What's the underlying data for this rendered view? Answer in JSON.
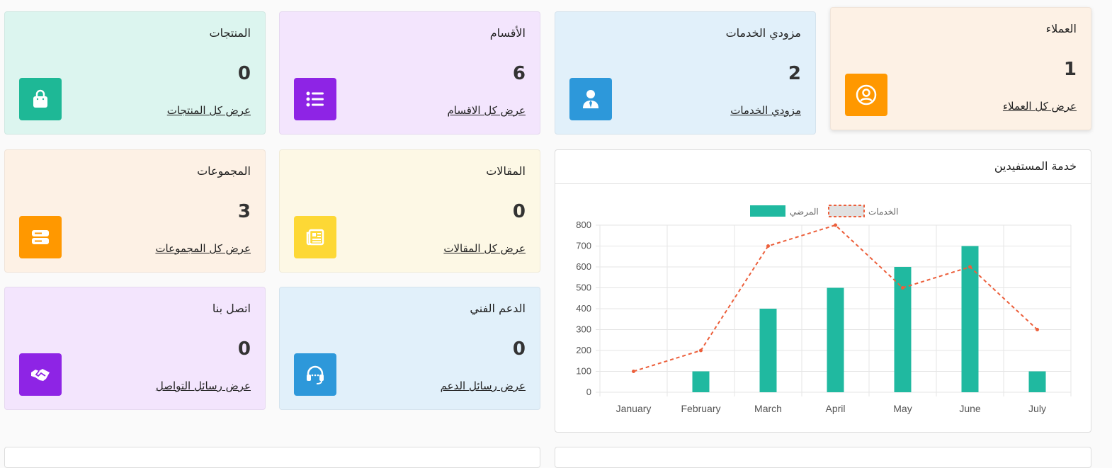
{
  "cards": {
    "clients": {
      "title": "العملاء",
      "value": "1",
      "link": "عرض كل العملاء",
      "bg": "#fdf1e5",
      "icon_bg": "#ff9800",
      "icon": "user-circle-icon"
    },
    "providers": {
      "title": "مزودي الخدمات",
      "value": "2",
      "link": "مزودي الخدمات",
      "bg": "#e1f0fa",
      "icon_bg": "#2d98da",
      "icon": "person-tie-icon"
    },
    "sections": {
      "title": "الأقسام",
      "value": "6",
      "link": "عرض كل الاقسام",
      "bg": "#f3e5fd",
      "icon_bg": "#8e24e5",
      "icon": "list-icon"
    },
    "products": {
      "title": "المنتجات",
      "value": "0",
      "link": "عرض كل المنتجات",
      "bg": "#dcf5ef",
      "icon_bg": "#1eb896",
      "icon": "shopping-bag-icon"
    },
    "articles": {
      "title": "المقالات",
      "value": "0",
      "link": "عرض كل المقالات",
      "bg": "#fdf8e5",
      "icon_bg": "#fdd835",
      "icon": "newspaper-icon"
    },
    "groups": {
      "title": "المجموعات",
      "value": "3",
      "link": "عرض كل المجموعات",
      "bg": "#fdf1e5",
      "icon_bg": "#ff9800",
      "icon": "server-icon"
    },
    "support": {
      "title": "الدعم الفني",
      "value": "0",
      "link": "عرض رسائل الدعم",
      "bg": "#e1f0fa",
      "icon_bg": "#2d98da",
      "icon": "headset-icon"
    },
    "contact": {
      "title": "اتصل بنا",
      "value": "0",
      "link": "عرض رسائل التواصل",
      "bg": "#f3e5fd",
      "icon_bg": "#8e24e5",
      "icon": "handshake-icon"
    }
  },
  "chart_card": {
    "title": "خدمة المستفيدين"
  },
  "chart_data": {
    "type": "bar",
    "categories": [
      "January",
      "February",
      "March",
      "April",
      "May",
      "June",
      "July"
    ],
    "series": [
      {
        "name": "المرضي",
        "type": "bar",
        "values": [
          0,
          100,
          400,
          500,
          600,
          700,
          100
        ],
        "color": "#20b9a0"
      },
      {
        "name": "الخدمات",
        "type": "line",
        "style": "dashed",
        "values": [
          100,
          200,
          700,
          800,
          500,
          600,
          300
        ],
        "color": "#ec5f3b"
      }
    ],
    "ylim": [
      0,
      800
    ],
    "yticks": [
      0,
      100,
      200,
      300,
      400,
      500,
      600,
      700,
      800
    ],
    "grid": true,
    "legend": "top"
  }
}
